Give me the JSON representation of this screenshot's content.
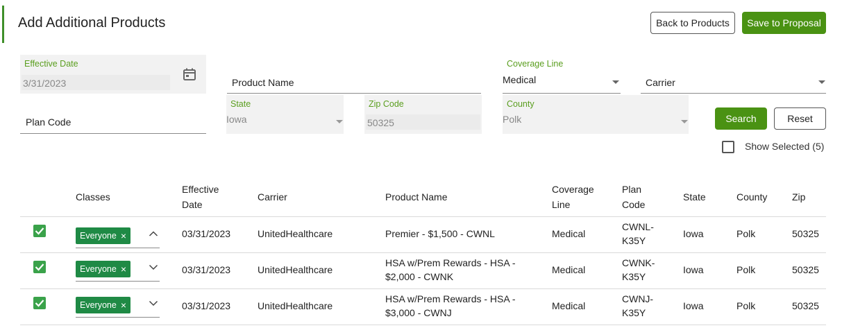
{
  "header": {
    "title": "Add Additional Products",
    "back_button": "Back to Products",
    "save_button": "Save to Proposal"
  },
  "filters": {
    "effective_date": {
      "label": "Effective Date",
      "value": "3/31/2023"
    },
    "product_name": {
      "placeholder": "Product Name"
    },
    "coverage_line": {
      "label": "Coverage Line",
      "value": "Medical"
    },
    "carrier": {
      "placeholder": "Carrier"
    },
    "plan_code": {
      "placeholder": "Plan Code"
    },
    "state": {
      "label": "State",
      "value": "Iowa"
    },
    "zip_code": {
      "label": "Zip Code",
      "value": "50325"
    },
    "county": {
      "label": "County",
      "value": "Polk"
    },
    "search_button": "Search",
    "reset_button": "Reset",
    "show_selected": "Show Selected (5)"
  },
  "table": {
    "headers": {
      "classes": "Classes",
      "effective_date_1": "Effective",
      "effective_date_2": "Date",
      "carrier": "Carrier",
      "product_name": "Product Name",
      "coverage_line_1": "Coverage",
      "coverage_line_2": "Line",
      "plan_code_1": "Plan",
      "plan_code_2": "Code",
      "state": "State",
      "county": "County",
      "zip": "Zip"
    },
    "rows": [
      {
        "class_chip": "Everyone",
        "effective_date": "03/31/2023",
        "carrier": "UnitedHealthcare",
        "product_line1": "Premier - $1,500 - CWNL",
        "product_line2": "",
        "coverage_line": "Medical",
        "plan_code_line1": "CWNL-",
        "plan_code_line2": "K35Y",
        "state": "Iowa",
        "county": "Polk",
        "zip": "50325"
      },
      {
        "class_chip": "Everyone",
        "effective_date": "03/31/2023",
        "carrier": "UnitedHealthcare",
        "product_line1": "HSA w/Prem Rewards - HSA -",
        "product_line2": "$2,000 - CWNK",
        "coverage_line": "Medical",
        "plan_code_line1": "CWNK-",
        "plan_code_line2": "K35Y",
        "state": "Iowa",
        "county": "Polk",
        "zip": "50325"
      },
      {
        "class_chip": "Everyone",
        "effective_date": "03/31/2023",
        "carrier": "UnitedHealthcare",
        "product_line1": "HSA w/Prem Rewards - HSA -",
        "product_line2": "$3,000 - CWNJ",
        "coverage_line": "Medical",
        "plan_code_line1": "CWNJ-",
        "plan_code_line2": "K35Y",
        "state": "Iowa",
        "county": "Polk",
        "zip": "50325"
      }
    ]
  },
  "colors": {
    "accent_green": "#4a9213",
    "label_green": "#5a9e1e",
    "chip_green": "#1f8a45",
    "checkbox_green": "#3aa24a"
  }
}
